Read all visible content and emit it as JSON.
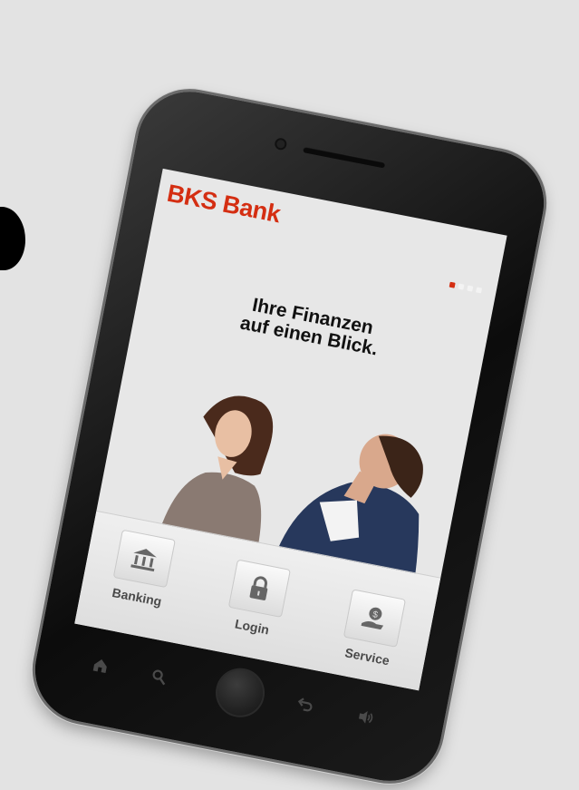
{
  "app": {
    "logo_text": "BKS Bank",
    "brand_color": "#d42e12"
  },
  "carousel": {
    "page_count": 4,
    "active_index": 0
  },
  "hero": {
    "headline_line1": "Ihre Finanzen",
    "headline_line2": "auf einen Blick."
  },
  "dock": {
    "items": [
      {
        "label": "Banking",
        "icon": "bank-icon"
      },
      {
        "label": "Login",
        "icon": "lock-icon"
      },
      {
        "label": "Service",
        "icon": "money-hand-icon"
      }
    ]
  },
  "hardware_keys": [
    "home-icon",
    "search-icon",
    "home-button",
    "back-icon",
    "volume-icon"
  ]
}
